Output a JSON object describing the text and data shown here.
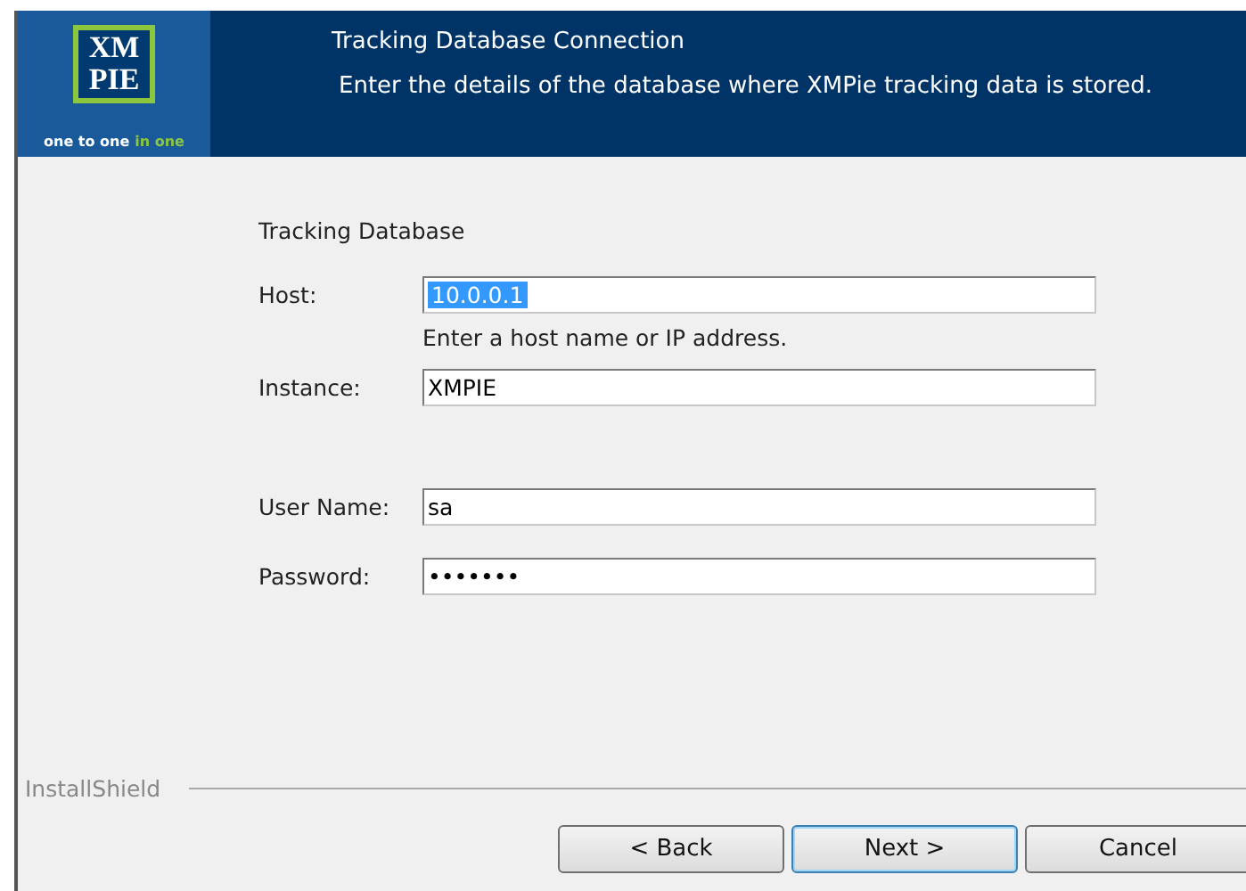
{
  "logo": {
    "mark_lines": [
      "XM",
      "PIE"
    ],
    "tagline": "one to one",
    "tagline_accent": "in one"
  },
  "header": {
    "title": "Tracking Database Connection",
    "subtitle": "Enter the details of the database where XMPie tracking data is stored."
  },
  "section_title": "Tracking Database",
  "fields": [
    {
      "label": "Host:",
      "value": "10.0.0.1",
      "selected": true,
      "hint": "Enter a host name or IP address."
    },
    {
      "label": "Instance:",
      "value": "XMPIE",
      "selected": false
    },
    {
      "label": "User Name:",
      "value": "sa",
      "selected": false
    },
    {
      "label": "Password:",
      "value": "•••••••",
      "selected": false
    }
  ],
  "brand": "InstallShield",
  "buttons": [
    {
      "label": "< Back",
      "default": false
    },
    {
      "label": "Next >",
      "default": true
    },
    {
      "label": "Cancel",
      "default": false
    }
  ]
}
